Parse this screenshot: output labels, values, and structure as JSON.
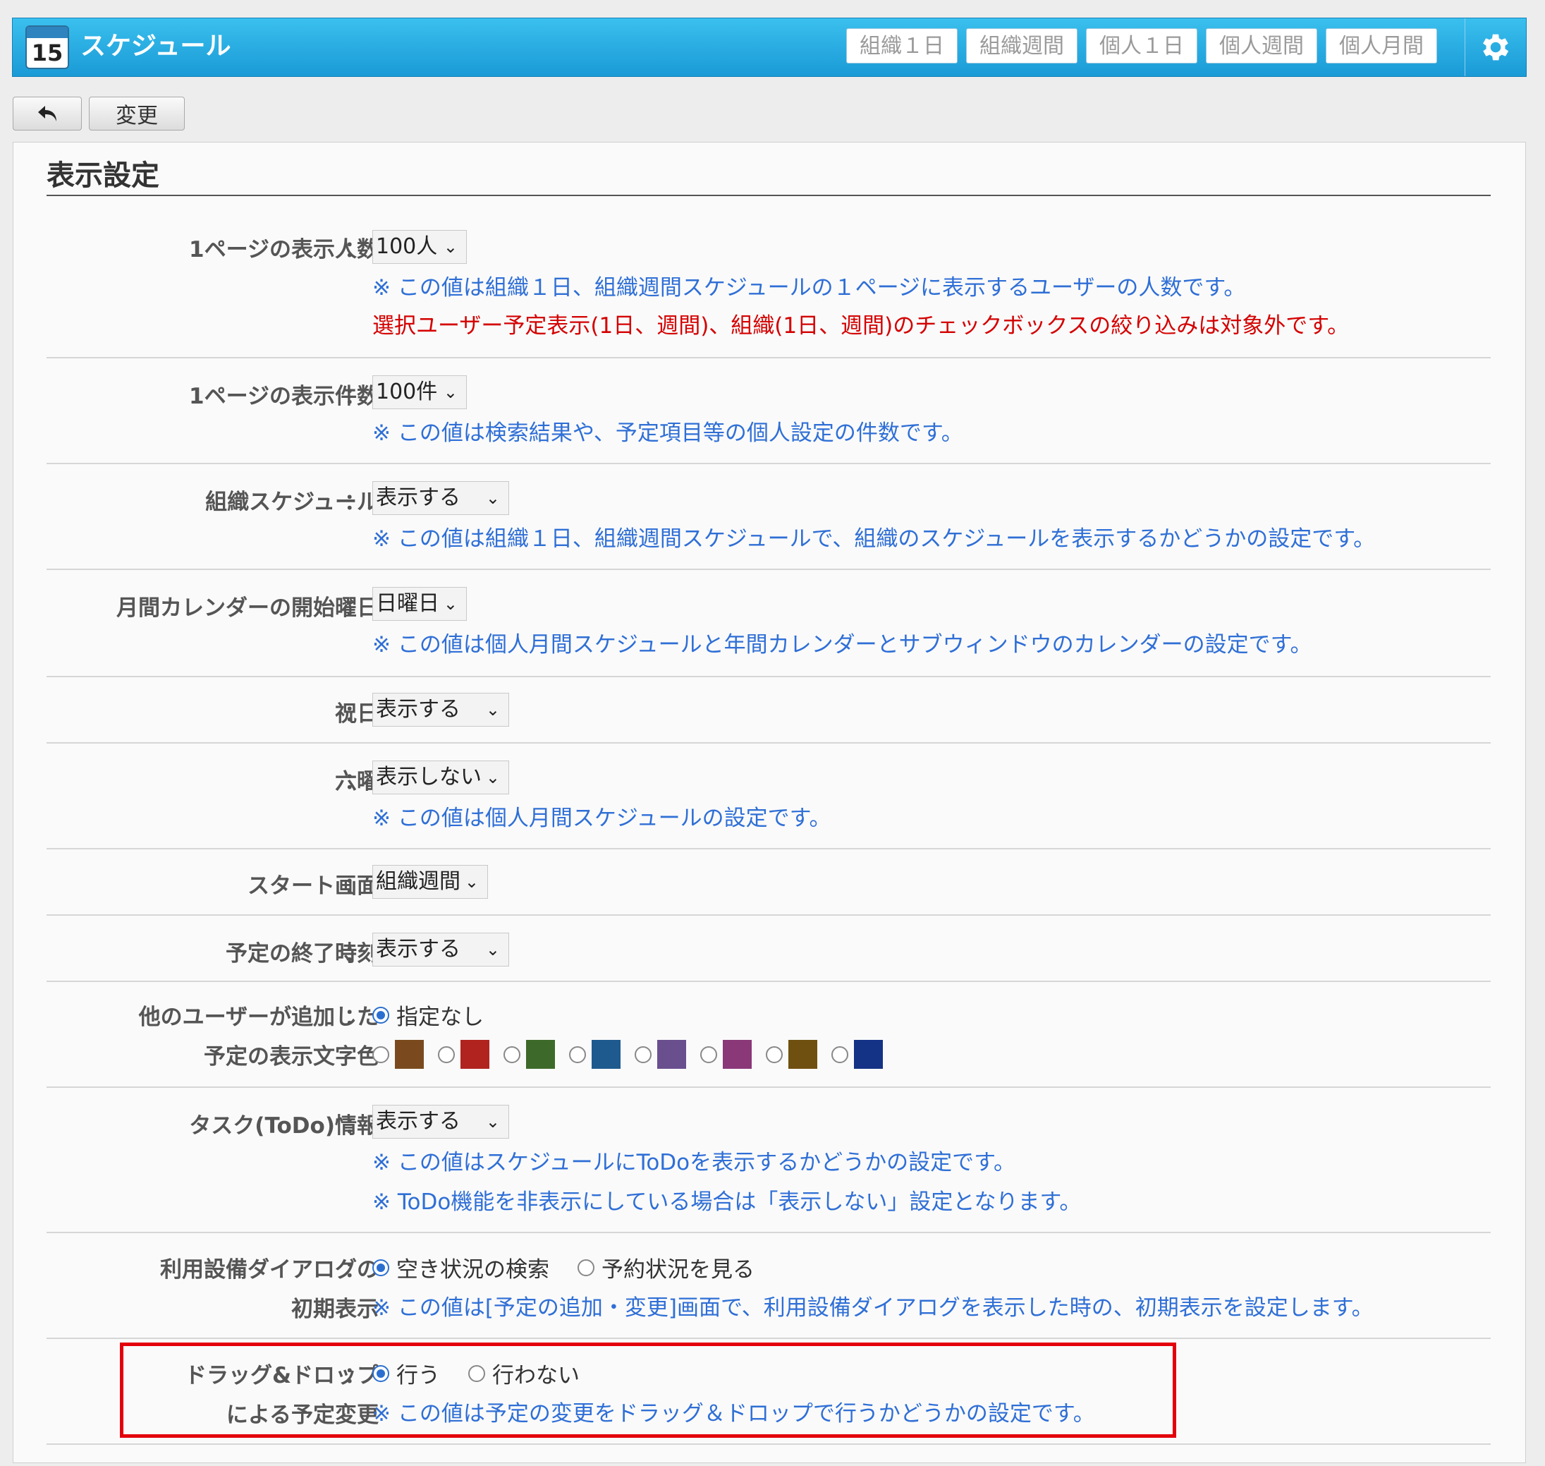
{
  "header": {
    "calendar_num": "15",
    "app_title": "スケジュール",
    "tabs": [
      "組織１日",
      "組織週間",
      "個人１日",
      "個人週間",
      "個人月間"
    ]
  },
  "toolbar": {
    "change_label": "変更"
  },
  "panel": {
    "title": "表示設定"
  },
  "settings": {
    "per_page_people": {
      "label": "1ページの表示人数",
      "value": "100人",
      "note1": "※ この値は組織１日、組織週間スケジュールの１ページに表示するユーザーの人数です。",
      "note2": "選択ユーザー予定表示(1日、週間)、組織(1日、週間)のチェックボックスの絞り込みは対象外です。"
    },
    "per_page_items": {
      "label": "1ページの表示件数",
      "value": "100件",
      "note": "※ この値は検索結果や、予定項目等の個人設定の件数です。"
    },
    "org_schedule": {
      "label": "組織スケジュール",
      "value": "表示する",
      "note": "※ この値は組織１日、組織週間スケジュールで、組織のスケジュールを表示するかどうかの設定です。"
    },
    "week_start": {
      "label": "月間カレンダーの開始曜日",
      "value": "日曜日",
      "note": "※ この値は個人月間スケジュールと年間カレンダーとサブウィンドウのカレンダーの設定です。"
    },
    "holidays": {
      "label": "祝日",
      "value": "表示する"
    },
    "rokuyo": {
      "label": "六曜",
      "value": "表示しない",
      "note": "※ この値は個人月間スケジュールの設定です。"
    },
    "start_screen": {
      "label": "スタート画面",
      "value": "組織週間"
    },
    "end_time": {
      "label": "予定の終了時刻",
      "value": "表示する"
    },
    "text_color": {
      "label1": "他のユーザーが追加した",
      "label2": "予定の表示文字色",
      "none_label": "指定なし",
      "colors": [
        "#7a4a1e",
        "#b0231e",
        "#3d6a2a",
        "#1e5a8e",
        "#6a4f8e",
        "#8a3878",
        "#705010",
        "#143286"
      ]
    },
    "todo": {
      "label": "タスク(ToDo)情報",
      "value": "表示する",
      "note1": "※ この値はスケジュールにToDoを表示するかどうかの設定です。",
      "note2": "※ ToDo機能を非表示にしている場合は「表示しない」設定となります。"
    },
    "facility_dialog": {
      "label1": "利用設備ダイアログの",
      "label2": "初期表示",
      "opt1": "空き状況の検索",
      "opt2": "予約状況を見る",
      "note": "※ この値は[予定の追加・変更]画面で、利用設備ダイアログを表示した時の、初期表示を設定します。"
    },
    "drag_drop": {
      "label1": "ドラッグ&ドロップ",
      "label2": "による予定変更",
      "opt1": "行う",
      "opt2": "行わない",
      "note": "※ この値は予定の変更をドラッグ＆ドロップで行うかどうかの設定です。"
    }
  },
  "colors": {
    "header_blue": "#1a9ad6",
    "link_blue": "#2f6fd6",
    "warning_red": "#d40000",
    "highlight_red": "#e3000b"
  }
}
